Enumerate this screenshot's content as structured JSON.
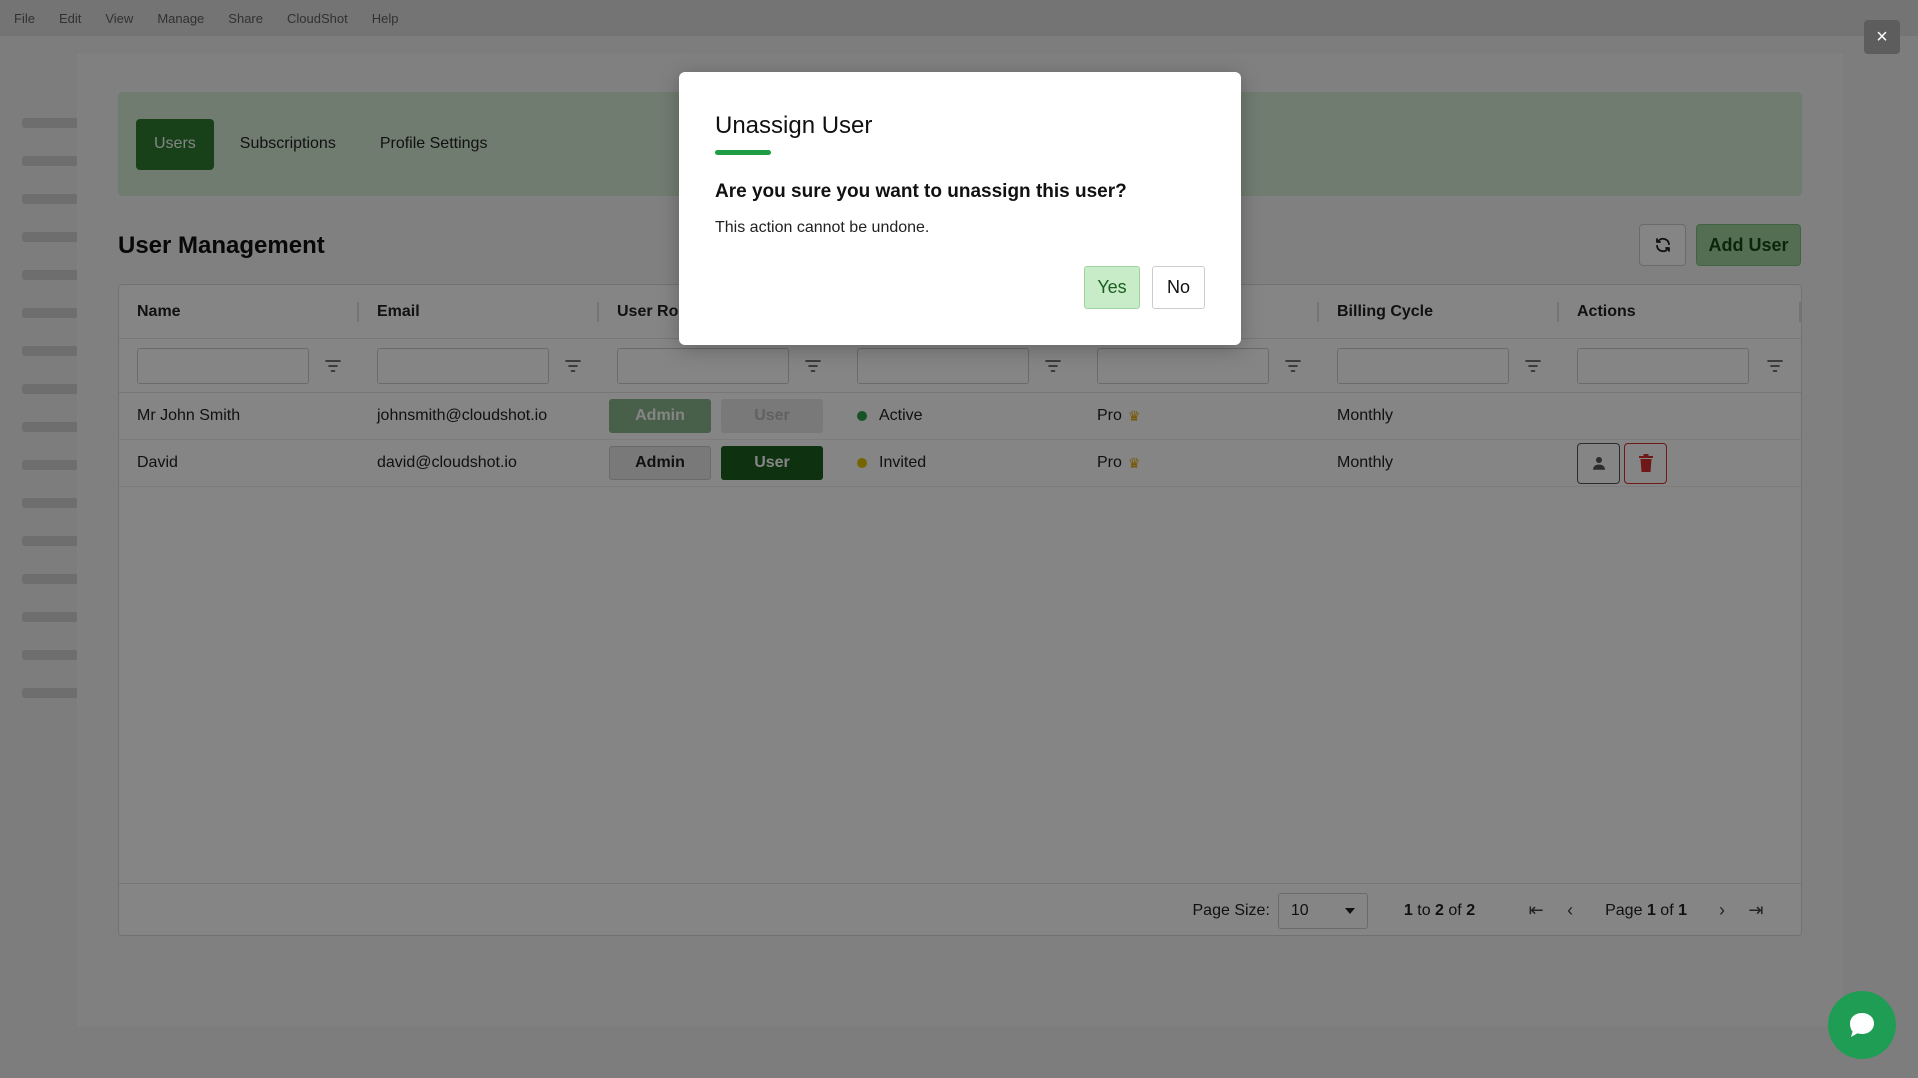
{
  "background": {
    "menu_items": [
      "File",
      "Edit",
      "View",
      "Manage",
      "Share",
      "CloudShot",
      "Help"
    ]
  },
  "close_label": "×",
  "tabs": [
    {
      "label": "Users",
      "active": true
    },
    {
      "label": "Subscriptions",
      "active": false
    },
    {
      "label": "Profile Settings",
      "active": false
    }
  ],
  "section": {
    "title": "User Management",
    "add_user_label": "Add User"
  },
  "grid": {
    "columns": [
      "Name",
      "Email",
      "User Role",
      "",
      "",
      "Billing Cycle",
      "Actions"
    ],
    "rows": [
      {
        "name": "Mr John Smith",
        "email": "johnsmith@cloudshot.io",
        "admin_label": "Admin",
        "user_label": "User",
        "status": "Active",
        "status_color": "#2e9d4d",
        "plan": "Pro",
        "crown": "♛",
        "billing": "Monthly"
      },
      {
        "name": "David",
        "email": "david@cloudshot.io",
        "admin_label": "Admin",
        "user_label": "User",
        "status": "Invited",
        "status_color": "#e0c000",
        "plan": "Pro",
        "crown": "♛",
        "billing": "Monthly"
      }
    ],
    "pager": {
      "page_size_label": "Page Size:",
      "page_size_value": "10",
      "range_from": "1",
      "range_to_word": "to",
      "range_to": "2",
      "of_word": "of",
      "total": "2",
      "page_word": "Page",
      "current_page": "1",
      "total_pages": "1"
    }
  },
  "confirm": {
    "title": "Unassign User",
    "question": "Are you sure you want to unassign this user?",
    "note": "This action cannot be undone.",
    "yes_label": "Yes",
    "no_label": "No"
  },
  "colors": {
    "accent": "#2e7d32",
    "underline": "#1f9d45",
    "delete": "#d32f2f",
    "chat": "#1f9d55"
  }
}
